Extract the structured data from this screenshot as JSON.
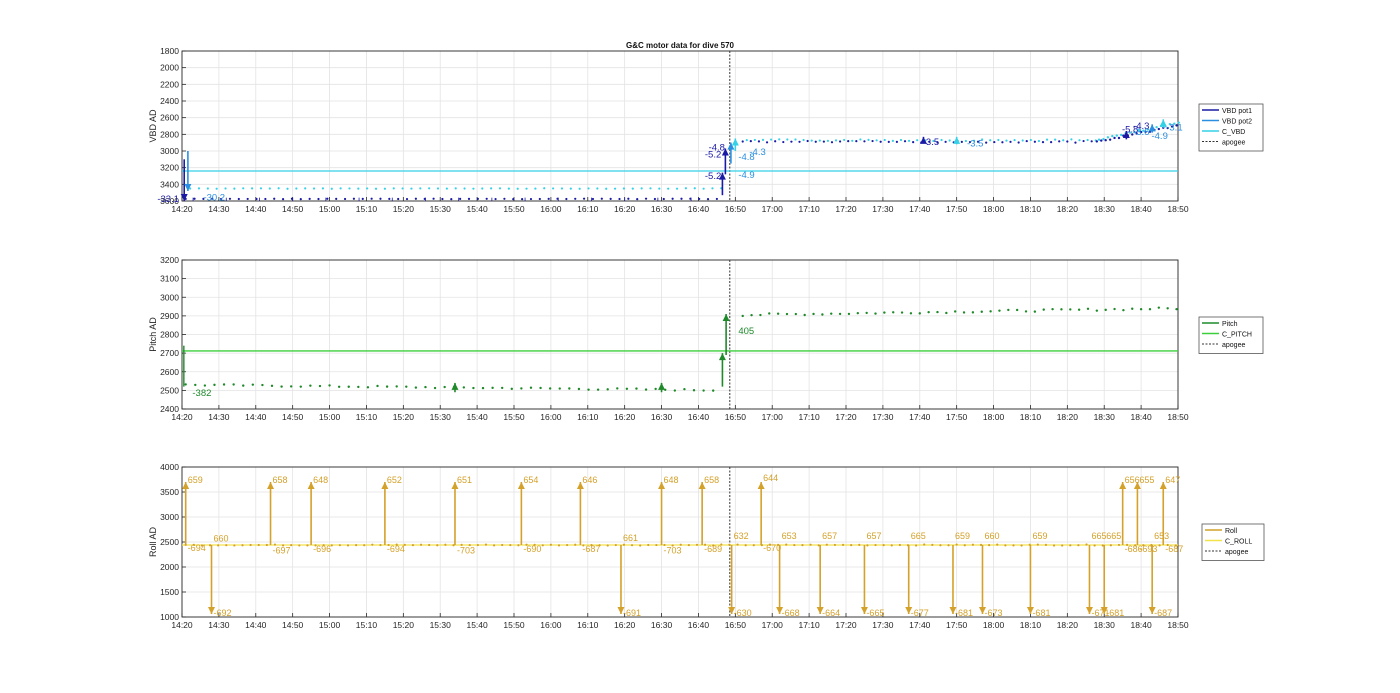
{
  "title": "G&C motor data for dive 570",
  "colors": {
    "vbd_pot1": "#1a1aa6",
    "vbd_pot2": "#2a8fe0",
    "c_vbd": "#35d1e6",
    "pitch": "#1f8a2a",
    "c_pitch": "#3ccf3c",
    "roll": "#d4a12a",
    "c_roll": "#f2e24a",
    "apogee": "#333333",
    "grid": "#e3e3e3",
    "axis": "#262626"
  },
  "x_ticks": [
    "14:20",
    "14:30",
    "14:40",
    "14:50",
    "15:00",
    "15:10",
    "15:20",
    "15:30",
    "15:40",
    "15:50",
    "16:00",
    "16:10",
    "16:20",
    "16:30",
    "16:40",
    "16:50",
    "17:00",
    "17:10",
    "17:20",
    "17:30",
    "17:40",
    "17:50",
    "18:00",
    "18:10",
    "18:20",
    "18:30",
    "18:40",
    "18:50"
  ],
  "chart_data": [
    {
      "type": "scatter",
      "ylabel": "VBD AD",
      "ylim": [
        1800,
        3600
      ],
      "y_reversed": true,
      "y_ticks": [
        1800,
        2000,
        2200,
        2400,
        2600,
        2800,
        3000,
        3200,
        3400,
        3600
      ],
      "xlim_minutes": [
        0,
        270
      ],
      "apogee_minute": 148.5,
      "legend": [
        "VBD pot1",
        "VBD pot2",
        "C_VBD",
        "apogee"
      ],
      "legend_position": "outside-right",
      "grid": true,
      "c_value": 3240,
      "series_pot1_level_pre": 3575,
      "series_pot2_level_pre": 3450,
      "series_post": 2890,
      "series_end": 2680,
      "annotations": [
        {
          "t": 0,
          "y": 3575,
          "text": "-33.1",
          "color": "vbd_pot1",
          "side": "left"
        },
        {
          "t": 5,
          "y": 3560,
          "text": "-30.2",
          "color": "vbd_pot2",
          "side": "right"
        },
        {
          "t": 147,
          "y": 3040,
          "text": "-5.2",
          "color": "vbd_pot1",
          "side": "left"
        },
        {
          "t": 147,
          "y": 3300,
          "text": "-5.2",
          "color": "vbd_pot1",
          "side": "left"
        },
        {
          "t": 148,
          "y": 2960,
          "text": "-4.8",
          "color": "vbd_pot1",
          "side": "left"
        },
        {
          "t": 150,
          "y": 3070,
          "text": "-4.8",
          "color": "vbd_pot2",
          "side": "right"
        },
        {
          "t": 153,
          "y": 3010,
          "text": "-4.3",
          "color": "vbd_pot2",
          "side": "right"
        },
        {
          "t": 150,
          "y": 3290,
          "text": "-4.9",
          "color": "vbd_pot2",
          "side": "right"
        },
        {
          "t": 200,
          "y": 2890,
          "text": "-3.5",
          "color": "vbd_pot1",
          "side": "right"
        },
        {
          "t": 212,
          "y": 2910,
          "text": "-3.5",
          "color": "vbd_pot2",
          "side": "right"
        },
        {
          "t": 254,
          "y": 2740,
          "text": "-5.8",
          "color": "vbd_pot1",
          "side": "right"
        },
        {
          "t": 257,
          "y": 2700,
          "text": "-4.3",
          "color": "vbd_pot1",
          "side": "right"
        },
        {
          "t": 257,
          "y": 2770,
          "text": "-3.6",
          "color": "vbd_pot2",
          "side": "right"
        },
        {
          "t": 266,
          "y": 2720,
          "text": "-3.1",
          "color": "vbd_pot2",
          "side": "right"
        },
        {
          "t": 262,
          "y": 2820,
          "text": "-4.9",
          "color": "vbd_pot2",
          "side": "right"
        }
      ]
    },
    {
      "type": "scatter",
      "ylabel": "Pitch AD",
      "ylim": [
        2400,
        3200
      ],
      "y_reversed": false,
      "y_ticks": [
        2400,
        2500,
        2600,
        2700,
        2800,
        2900,
        3000,
        3100,
        3200
      ],
      "xlim_minutes": [
        0,
        270
      ],
      "apogee_minute": 148.5,
      "legend": [
        "Pitch",
        "C_PITCH",
        "apogee"
      ],
      "legend_position": "outside-right",
      "grid": true,
      "c_value": 2712,
      "annotations": [
        {
          "t": 2,
          "y": 2485,
          "text": "-382",
          "color": "pitch",
          "side": "right"
        },
        {
          "t": 150,
          "y": 2820,
          "text": "405",
          "color": "pitch",
          "side": "right"
        }
      ]
    },
    {
      "type": "scatter",
      "ylabel": "Roll AD",
      "ylim": [
        1000,
        4000
      ],
      "y_reversed": false,
      "y_ticks": [
        1000,
        1500,
        2000,
        2500,
        3000,
        3500,
        4000
      ],
      "xlim_minutes": [
        0,
        270
      ],
      "apogee_minute": 148.5,
      "legend": [
        "Roll",
        "C_ROLL",
        "apogee"
      ],
      "legend_position": "outside-right",
      "grid": true,
      "c_value": 2440,
      "roll_moves": [
        {
          "t": 1,
          "dir": "up",
          "label": "659",
          "label_y": 3740
        },
        {
          "t": 1,
          "dir": "down",
          "label": "-694",
          "label_y": 2300
        },
        {
          "t": 8,
          "dir": "down",
          "label": "-692",
          "label_y": 1000
        },
        {
          "t": 8,
          "dir": "up",
          "label": "660",
          "label_y": 2570
        },
        {
          "t": 24,
          "dir": "up",
          "label": "658",
          "label_y": 3740
        },
        {
          "t": 24,
          "dir": "down",
          "label": "-697",
          "label_y": 2250
        },
        {
          "t": 35,
          "dir": "up",
          "label": "648",
          "label_y": 3740
        },
        {
          "t": 35,
          "dir": "down",
          "label": "-696",
          "label_y": 2280
        },
        {
          "t": 55,
          "dir": "up",
          "label": "652",
          "label_y": 3740
        },
        {
          "t": 55,
          "dir": "down",
          "label": "-694",
          "label_y": 2280
        },
        {
          "t": 74,
          "dir": "up",
          "label": "651",
          "label_y": 3740
        },
        {
          "t": 74,
          "dir": "down",
          "label": "-703",
          "label_y": 2250
        },
        {
          "t": 92,
          "dir": "up",
          "label": "654",
          "label_y": 3740
        },
        {
          "t": 92,
          "dir": "down",
          "label": "-690",
          "label_y": 2280
        },
        {
          "t": 108,
          "dir": "up",
          "label": "646",
          "label_y": 3740
        },
        {
          "t": 108,
          "dir": "down",
          "label": "-687",
          "label_y": 2280
        },
        {
          "t": 119,
          "dir": "up",
          "label": "661",
          "label_y": 2580
        },
        {
          "t": 119,
          "dir": "down",
          "label": "-691",
          "label_y": 1000
        },
        {
          "t": 130,
          "dir": "up",
          "label": "648",
          "label_y": 3740
        },
        {
          "t": 130,
          "dir": "down",
          "label": "-703",
          "label_y": 2250
        },
        {
          "t": 141,
          "dir": "up",
          "label": "658",
          "label_y": 3740
        },
        {
          "t": 141,
          "dir": "down",
          "label": "-689",
          "label_y": 2280
        },
        {
          "t": 149,
          "dir": "up",
          "label": "632",
          "label_y": 2620
        },
        {
          "t": 149,
          "dir": "down",
          "label": "-630",
          "label_y": 1000
        },
        {
          "t": 157,
          "dir": "up",
          "label": "644",
          "label_y": 3780
        },
        {
          "t": 157,
          "dir": "down",
          "label": "-670",
          "label_y": 2300
        },
        {
          "t": 162,
          "dir": "up",
          "label": "653",
          "label_y": 2620
        },
        {
          "t": 162,
          "dir": "down",
          "label": "-668",
          "label_y": 1000
        },
        {
          "t": 173,
          "dir": "up",
          "label": "657",
          "label_y": 2620
        },
        {
          "t": 173,
          "dir": "down",
          "label": "-664",
          "label_y": 1000
        },
        {
          "t": 185,
          "dir": "up",
          "label": "657",
          "label_y": 2620
        },
        {
          "t": 185,
          "dir": "down",
          "label": "-665",
          "label_y": 1000
        },
        {
          "t": 197,
          "dir": "up",
          "label": "665",
          "label_y": 2620
        },
        {
          "t": 197,
          "dir": "down",
          "label": "-677",
          "label_y": 1000
        },
        {
          "t": 209,
          "dir": "up",
          "label": "659",
          "label_y": 2620
        },
        {
          "t": 209,
          "dir": "down",
          "label": "-681",
          "label_y": 1000
        },
        {
          "t": 217,
          "dir": "up",
          "label": "660",
          "label_y": 2620
        },
        {
          "t": 217,
          "dir": "down",
          "label": "-673",
          "label_y": 1000
        },
        {
          "t": 230,
          "dir": "up",
          "label": "659",
          "label_y": 2620
        },
        {
          "t": 230,
          "dir": "down",
          "label": "-681",
          "label_y": 1000
        },
        {
          "t": 246,
          "dir": "up",
          "label": "665",
          "label_y": 2620
        },
        {
          "t": 246,
          "dir": "down",
          "label": "-671",
          "label_y": 1000
        },
        {
          "t": 250,
          "dir": "up",
          "label": "665",
          "label_y": 2620
        },
        {
          "t": 250,
          "dir": "down",
          "label": "-681",
          "label_y": 1000
        },
        {
          "t": 255,
          "dir": "up",
          "label": "656",
          "label_y": 3740
        },
        {
          "t": 255,
          "dir": "down",
          "label": "-686",
          "label_y": 2280
        },
        {
          "t": 259,
          "dir": "up",
          "label": "655",
          "label_y": 3740
        },
        {
          "t": 259,
          "dir": "down",
          "label": "-693",
          "label_y": 2280
        },
        {
          "t": 263,
          "dir": "up",
          "label": "653",
          "label_y": 2620
        },
        {
          "t": 263,
          "dir": "down",
          "label": "-687",
          "label_y": 1000
        },
        {
          "t": 266,
          "dir": "up",
          "label": "647",
          "label_y": 3740
        },
        {
          "t": 266,
          "dir": "down",
          "label": "-687",
          "label_y": 2280
        }
      ]
    }
  ]
}
